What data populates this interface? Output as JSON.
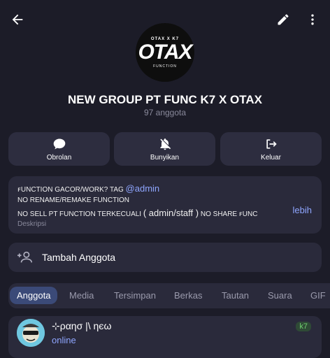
{
  "header": {
    "back_icon": "arrow-left-icon",
    "edit_icon": "pencil-icon",
    "more_icon": "more-vertical-icon"
  },
  "group": {
    "logo_top": "OTAX X K7",
    "logo_main": "OTAX",
    "logo_bottom": "FUNCTION",
    "title": "NEW GROUP PT FUNC K7 X OTAX",
    "members": "97 anggota"
  },
  "actions": [
    {
      "label": "Obrolan",
      "icon": "chat-bubble-icon"
    },
    {
      "label": "Bunyikan",
      "icon": "bell-off-icon"
    },
    {
      "label": "Keluar",
      "icon": "exit-icon"
    }
  ],
  "description": {
    "line1_text": "ꜰUNCTION GACOR/WORK? TAG ",
    "line1_link": "@admin",
    "line2": "NO RENAME/REMAKE FUNCTION",
    "line3_pre": "NO SELL PT FUNCTION TERKECUALI ",
    "line3_paren": "( admin/staff )",
    "line3_post": " NO SHARE ꜰUNC",
    "more": "lebih",
    "label": "Deskripsi"
  },
  "add_member": {
    "label": "Tambah Anggota",
    "icon": "add-person-icon"
  },
  "tabs": [
    "Anggota",
    "Media",
    "Tersimpan",
    "Berkas",
    "Tautan",
    "Suara",
    "GIF"
  ],
  "member": {
    "name": "⊹ραησ |\\ ηєω",
    "status": "online",
    "badge": "k7"
  },
  "colors": {
    "background": "#1c1c28",
    "card": "#2a2a3b",
    "accent": "#8fa6ff",
    "active_tab": "#3b4a78",
    "badge": "#6fd06f"
  }
}
